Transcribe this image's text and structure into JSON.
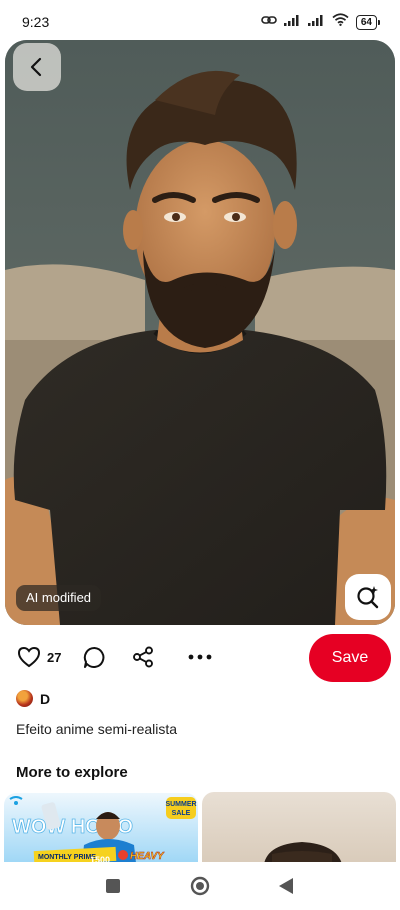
{
  "status_bar": {
    "time": "9:23",
    "battery": "64",
    "icons": [
      "link-icon",
      "signal-icon",
      "signal-icon",
      "wifi-icon",
      "battery-icon"
    ]
  },
  "pin": {
    "ai_badge": "AI modified",
    "like_count": "27",
    "save_label": "Save",
    "author_name": "D",
    "description": "Efeito anime semi-realista"
  },
  "explore": {
    "title": "More to explore",
    "card1": {
      "banner_text": "WOW HOMO",
      "badge_top": "SUMMER",
      "badge_bottom": "SALE",
      "strip_text": "MONTHLY PRIME",
      "strip_number": "1500",
      "heavy_text": "HEAVY"
    }
  },
  "colors": {
    "accent": "#e60023",
    "shirt": "#2a2621",
    "wall": "#5b6763",
    "skin": "#c58a57"
  }
}
